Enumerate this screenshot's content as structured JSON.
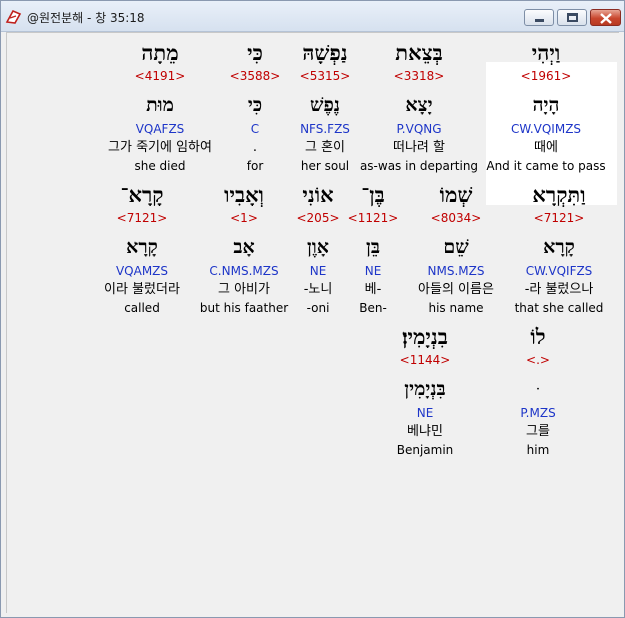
{
  "window": {
    "title": "@원전분해 - 창 35:18"
  },
  "colors": {
    "strong": "#c00000",
    "morph": "#1d35c8",
    "highlight": "#ffffff"
  },
  "words": [
    {
      "hebrew": "וַיְהִי",
      "strong": "<1961>",
      "lex": "הָיָה",
      "morph": "CW.VQIMZS",
      "korean": "때에",
      "english": "And it came to pass"
    },
    {
      "hebrew": "בְּצֵאת",
      "strong": "<3318>",
      "lex": "יָצָא",
      "morph": "P.VQNG",
      "korean": "떠나려 할",
      "english": "as-was in departing"
    },
    {
      "hebrew": "נַפְשָׁהּ",
      "strong": "<5315>",
      "lex": "נֶפֶשׁ",
      "morph": "NFS.FZS",
      "korean": "그 혼이",
      "english": "her soul"
    },
    {
      "hebrew": "כִּי",
      "strong": "<3588>",
      "lex": "כִּי",
      "morph": "C",
      "korean": ".",
      "english": "for"
    },
    {
      "hebrew": "מֵתָה",
      "strong": "<4191>",
      "lex": "מוּת",
      "morph": "VQAFZS",
      "korean": "그가 죽기에 임하여",
      "english": "she died"
    },
    {
      "hebrew": "וַתִּקְרָא",
      "strong": "<7121>",
      "lex": "קָרָא",
      "morph": "CW.VQIFZS",
      "korean": "-라 불렀으나",
      "english": "that she called"
    },
    {
      "hebrew": "שְׁמוֹ",
      "strong": "<8034>",
      "lex": "שֵׁם",
      "morph": "NMS.MZS",
      "korean": "아들의 이름은",
      "english": "his name"
    },
    {
      "hebrew": "בֶּן־",
      "strong": "<1121>",
      "lex": "בֵּן",
      "morph": "NE",
      "korean": "베-",
      "english": "Ben-"
    },
    {
      "hebrew": "אוֹנִי",
      "strong": "<205>",
      "lex": "אָוֶן",
      "morph": "NE",
      "korean": "-노니",
      "english": "-oni"
    },
    {
      "hebrew": "וְאָבִיו",
      "strong": "<1>",
      "lex": "אָב",
      "morph": "C.NMS.MZS",
      "korean": "그 아비가",
      "english": "but his faather"
    },
    {
      "hebrew": "קָרָא־",
      "strong": "<7121>",
      "lex": "קָרָא",
      "morph": "VQAMZS",
      "korean": "이라 불렀더라",
      "english": "called"
    },
    {
      "hebrew": "לוֹ",
      "strong": "<.>",
      "lex": "ּ",
      "morph": "P.MZS",
      "korean": "그를",
      "english": "him"
    },
    {
      "hebrew": "בִנְיָמִין׃",
      "strong": "<1144>",
      "lex": "בִּנְיָמִין",
      "morph": "NE",
      "korean": "베냐민",
      "english": "Benjamin"
    }
  ]
}
